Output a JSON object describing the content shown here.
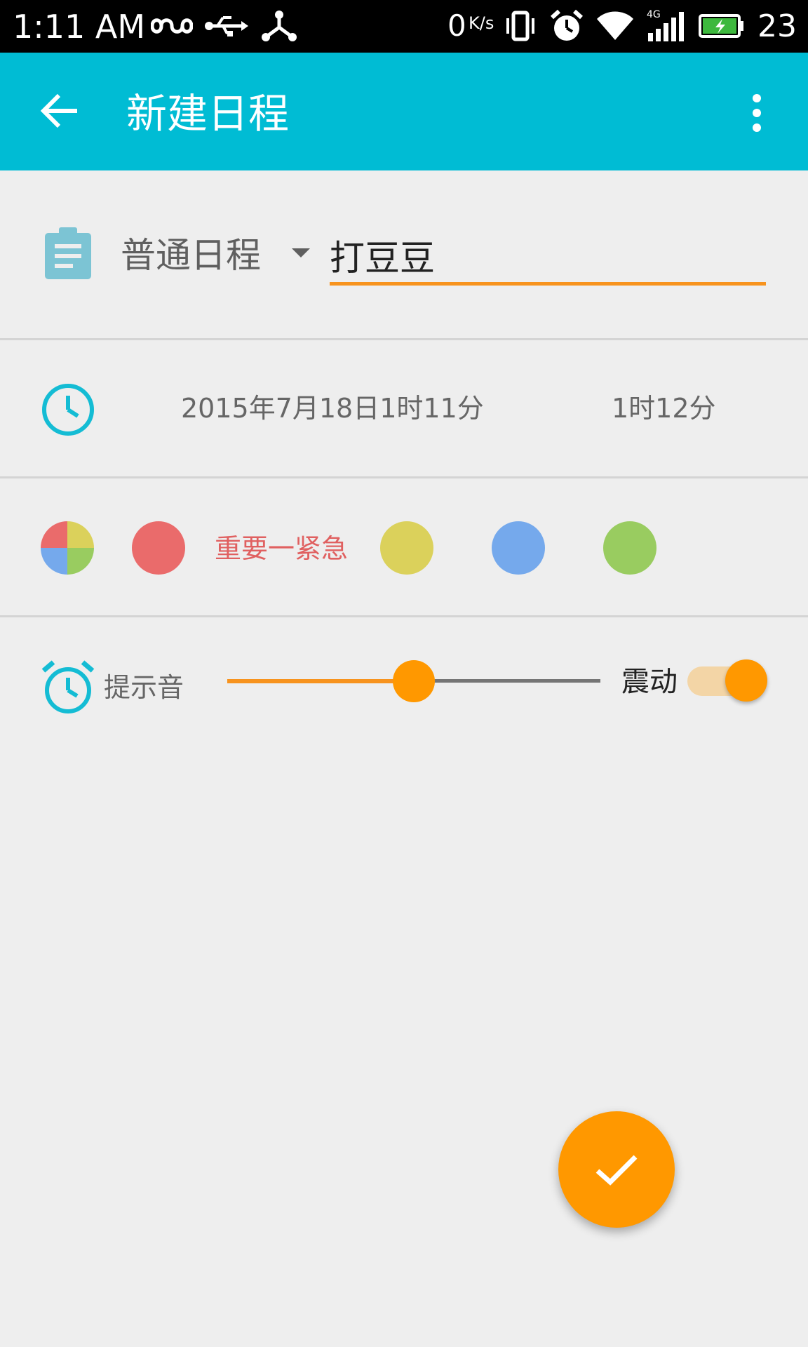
{
  "status_bar": {
    "time": "1:11 AM",
    "net_speed_value": "0",
    "net_speed_unit": "K/s",
    "battery_level": "23",
    "icons": [
      "infinity-icon",
      "usb-icon",
      "share-icon",
      "vibrate-icon",
      "alarm-icon",
      "wifi-icon",
      "signal-4g-icon",
      "battery-charging-icon"
    ]
  },
  "app_bar": {
    "title": "新建日程",
    "back_icon": "arrow-back-icon",
    "menu_icon": "more-vert-icon",
    "color": "#00bcd4"
  },
  "event": {
    "type_label": "普通日程",
    "title_value": "打豆豆",
    "type_icon": "clipboard-icon"
  },
  "time": {
    "start": "2015年7月18日1时11分",
    "end": "1时12分",
    "icon": "clock-icon"
  },
  "priority": {
    "selected_label": "重要一紧急",
    "colors": {
      "important_urgent": "#ea6b6b",
      "yellow": "#dbd15b",
      "blue": "#75a9ec",
      "green": "#99cc60"
    },
    "selected_color": "#e06060"
  },
  "alert": {
    "sound_label": "提示音",
    "sound_level_fraction": 0.5,
    "vibrate_label": "震动",
    "vibrate_on": true,
    "icon": "alarm-icon",
    "accent": "#ff9800"
  },
  "fab": {
    "icon": "check-icon"
  }
}
